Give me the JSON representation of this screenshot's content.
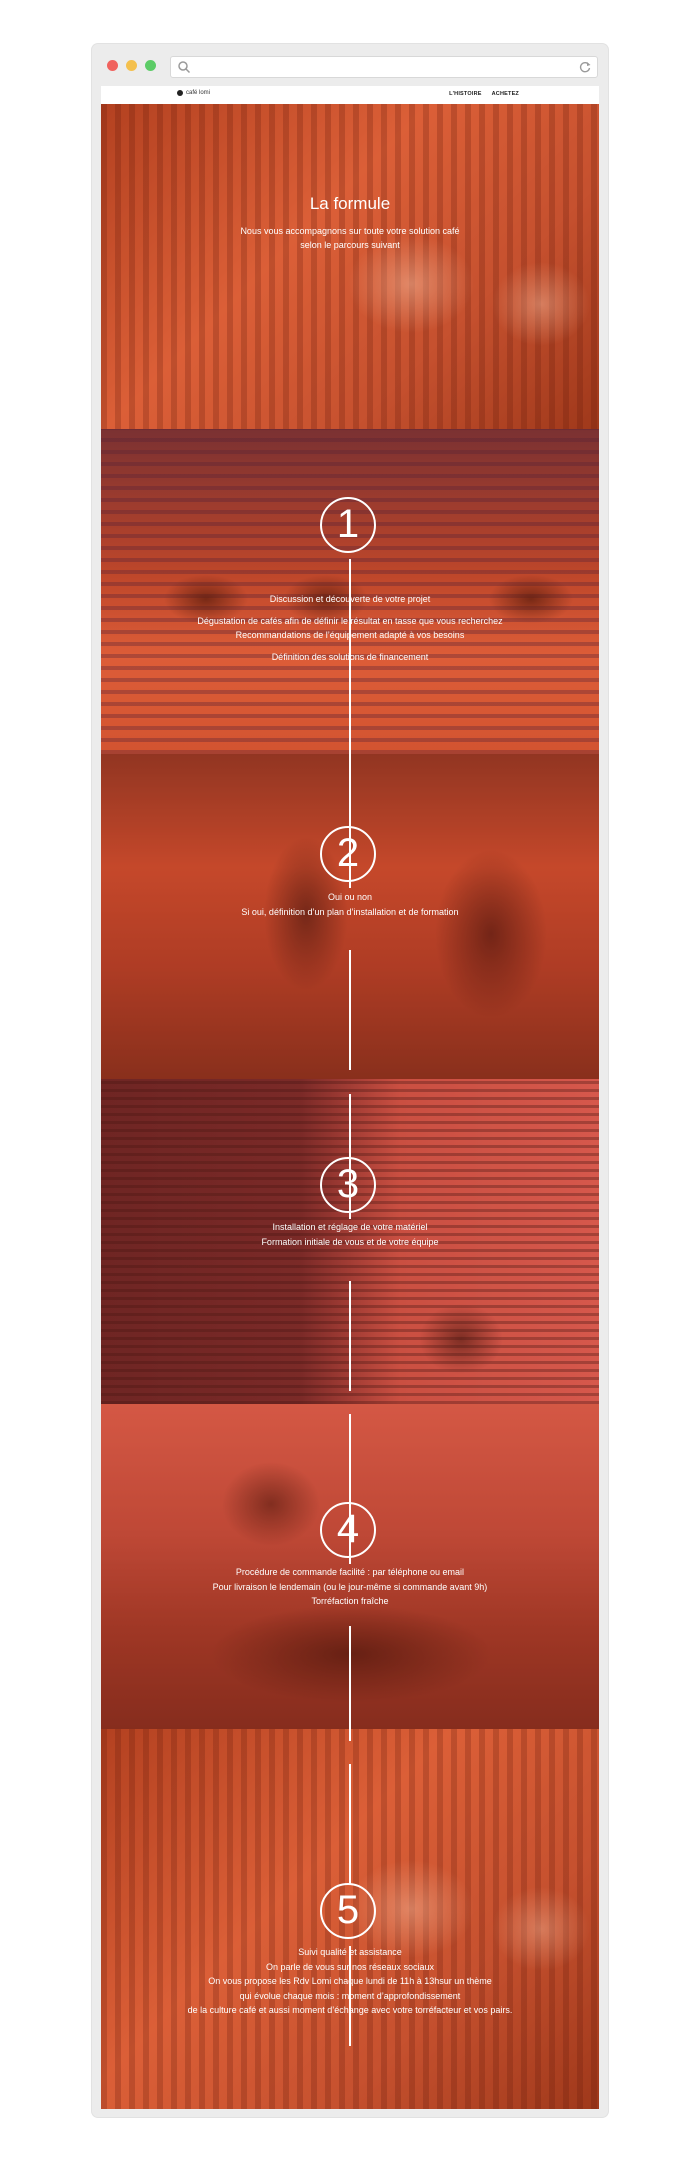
{
  "window": {
    "controls": [
      "close",
      "minimize",
      "maximize"
    ]
  },
  "nav": {
    "logo": "café lomi",
    "links": [
      "L'HISTOIRE",
      "ACHETEZ"
    ]
  },
  "hero": {
    "title": "La formule",
    "subtitle": [
      "Nous vous accompagnons sur toute votre solution café",
      "selon le parcours suivant"
    ]
  },
  "steps": [
    {
      "number": "1",
      "lines": [
        "Discussion et découverte de votre projet",
        "",
        "Dégustation de cafés afin de définir le résultat en tasse que vous recherchez",
        "Recommandations de l’équipement adapté à vos besoins",
        "",
        "Définition des solutions de financement"
      ]
    },
    {
      "number": "2",
      "lines": [
        "Oui ou non",
        "Si oui, définition d’un plan d’installation et de formation"
      ]
    },
    {
      "number": "3",
      "lines": [
        "Installation et réglage de votre matériel",
        "Formation initiale de vous et de votre équipe"
      ]
    },
    {
      "number": "4",
      "lines": [
        "Procédure de commande facilité : par téléphone ou email",
        "Pour livraison le lendemain (ou le jour-même si commande avant 9h)",
        "Torréfaction fraîche"
      ]
    },
    {
      "number": "5",
      "lines": [
        "Suivi qualité et assistance",
        "On parle de vous sur nos réseaux sociaux",
        "On vous propose les Rdv Lomi chaque lundi de 11h à 13hsur un thème",
        "qui évolue chaque mois : moment d’approfondissement",
        "de la culture café et aussi moment d’échange avec votre torréfacteur et vos pairs."
      ]
    }
  ],
  "colors": {
    "accent_overlay": "#d24628",
    "text": "#ffffff",
    "timeline": "#ffffff"
  }
}
